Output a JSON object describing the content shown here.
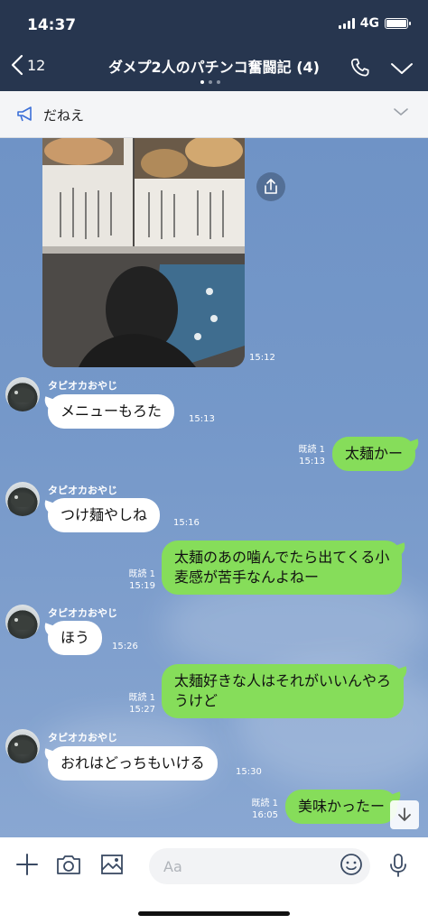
{
  "status": {
    "time": "14:37",
    "network": "4G"
  },
  "header": {
    "back_count": "12",
    "title": "ダメプ2人のパチンコ奮闘記 (4)"
  },
  "announcement": {
    "text": "だねえ"
  },
  "photo_time": "15:12",
  "messages": [
    {
      "side": "in",
      "sender": "タピオカおやじ",
      "text": "メニューもろた",
      "time": "15:13"
    },
    {
      "side": "out",
      "read": "既読 1",
      "text": "太麺かー",
      "time": "15:13"
    },
    {
      "side": "in",
      "sender": "タピオカおやじ",
      "text": "つけ麺やしね",
      "time": "15:16"
    },
    {
      "side": "out",
      "read": "既読 1",
      "line1": "太麺のあの噛んでたら出てくる小",
      "line2": "麦感が苦手なんよねー",
      "time": "15:19"
    },
    {
      "side": "in",
      "sender": "タピオカおやじ",
      "text": "ほう",
      "time": "15:26"
    },
    {
      "side": "out",
      "read": "既読 1",
      "line1": "太麺好きな人はそれがいいんやろ",
      "line2": "うけど",
      "time": "15:27"
    },
    {
      "side": "in",
      "sender": "タピオカおやじ",
      "text": "おれはどっちもいける",
      "time": "15:30"
    },
    {
      "side": "out",
      "read": "既読 1",
      "text": "美味かったー",
      "time": "16:05"
    }
  ],
  "input": {
    "placeholder": "Aa"
  },
  "icons": {
    "back": "chevron-left-icon",
    "call": "phone-icon",
    "more": "chevron-down-icon",
    "announce": "megaphone-icon",
    "share": "share-icon",
    "scroll": "arrow-down-icon",
    "add": "plus-icon",
    "camera": "camera-icon",
    "image": "image-icon",
    "emoji": "emoji-icon",
    "mic": "microphone-icon"
  },
  "colors": {
    "header_bg": "#27364f",
    "bubble_out": "#86dd5a",
    "bubble_in": "#ffffff",
    "chat_bg": "#7598c9"
  }
}
